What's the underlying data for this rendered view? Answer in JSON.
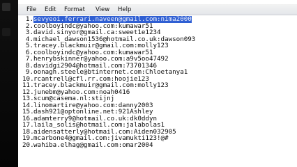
{
  "menu": [
    "File",
    "Edit",
    "Format",
    "View",
    "Help"
  ],
  "lines": [
    {
      "num": "1.",
      "text": "sevyeoi.ferrari.naveen@gmail.com:nima2000",
      "selected": true
    },
    {
      "num": "2.",
      "text": "coolboyindc@yahoo.com:kumawar51"
    },
    {
      "num": "3.",
      "text": "david.sinyor@gmail.ca:sweet1e1234"
    },
    {
      "num": "4.",
      "text": "michael_dawson1536@hotmail.co.uk:dawson093"
    },
    {
      "num": "5.",
      "text": "tracey.blackmuir@gmail.com:molly123"
    },
    {
      "num": "6.",
      "text": "coolboyindc@yahoo.com:kumawar51"
    },
    {
      "num": "7.",
      "text": "henrybskinner@yahoo.com:a9v5oo47492"
    },
    {
      "num": "8.",
      "text": "davidgi2904@hotmail.com:73701346"
    },
    {
      "num": "9.",
      "text": "oonagh.steele@btinternet.com:Chloetanya1"
    },
    {
      "num": "10.",
      "text": "rcantrell@cfl.rr.com:hoojie123"
    },
    {
      "num": "11.",
      "text": "tracey.blackmuir@gmail.com:molly123"
    },
    {
      "num": "12.",
      "text": "junebm@yahoo.com:noah0416"
    },
    {
      "num": "13.",
      "text": "scum@casema.nl:stijnj"
    },
    {
      "num": "14.",
      "text": "linomartire@yahoo.com:danny2003"
    },
    {
      "num": "15.",
      "text": "dash921@optonline.net:921Ashley"
    },
    {
      "num": "16.",
      "text": "adamterry9@hotmail.co.uk:dk0ddyn"
    },
    {
      "num": "17.",
      "text": "laila_solis@hotmail.com:jalabolas1"
    },
    {
      "num": "18.",
      "text": "aidensatterly@hotmail.com:Aiden032905"
    },
    {
      "num": "19.",
      "text": "mcarbone4@gmail.com:jivamukti123!@#"
    },
    {
      "num": "20.",
      "text": "wahiba.elhag@gmail.com:omar2004"
    }
  ]
}
